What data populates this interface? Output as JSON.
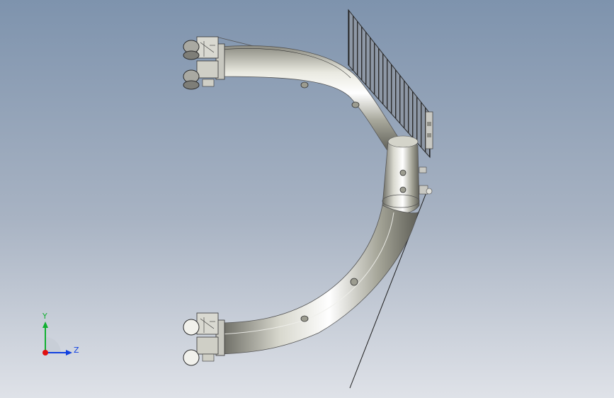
{
  "viewport": {
    "bg_top": "#7e93ad",
    "bg_bottom": "#dfe2e8"
  },
  "model": {
    "pipe_color": "#b9b9ac",
    "pipe_shadow": "#6e6e64",
    "highlight": "#f4f4ee",
    "panel_color": "#5b5b5b"
  },
  "triad": {
    "x_label": "Z",
    "y_label": "Y",
    "x_color": "#1040e0",
    "y_color": "#10b030",
    "origin_color": "#e01010"
  }
}
